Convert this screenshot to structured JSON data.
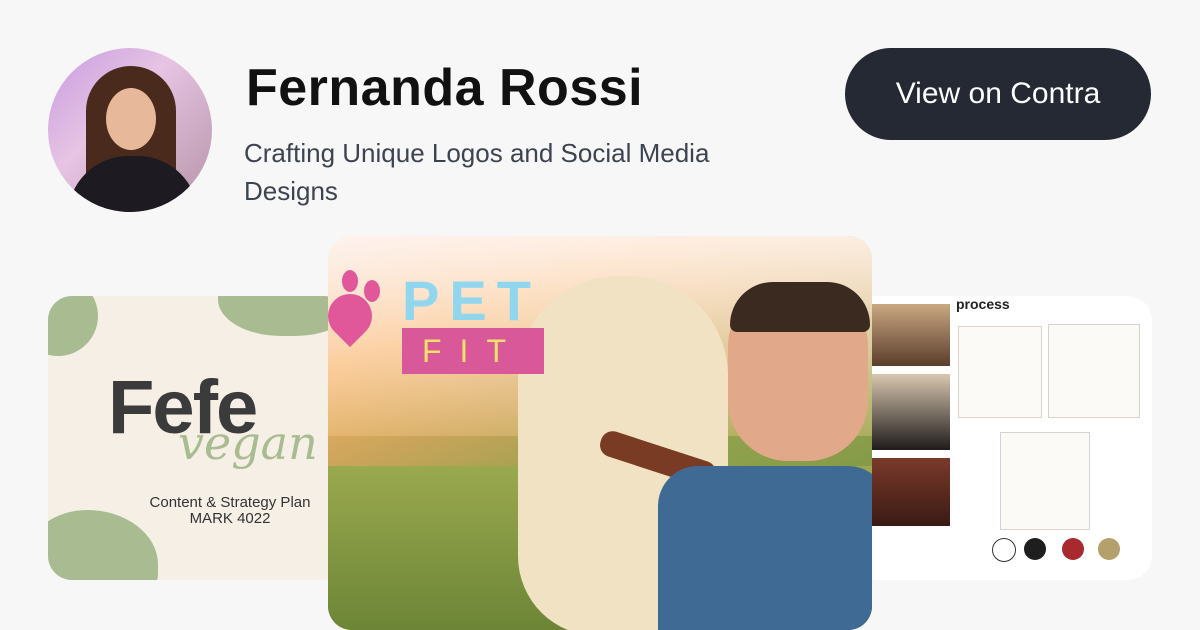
{
  "profile": {
    "name": "Fernanda Rossi",
    "tagline": "Crafting Unique Logos and Social Media Designs"
  },
  "cta": {
    "label": "View on Contra"
  },
  "cards": {
    "left": {
      "brand": "Fefe",
      "script": "vegan",
      "line1": "Content & Strategy Plan",
      "line2": "MARK 4022"
    },
    "main": {
      "logo_top": "PET",
      "logo_bottom": "FIT"
    },
    "right": {
      "title": "process",
      "swatches": [
        "#ffffff",
        "#1e1e1e",
        "#a82a2e",
        "#b4a06a"
      ]
    }
  }
}
